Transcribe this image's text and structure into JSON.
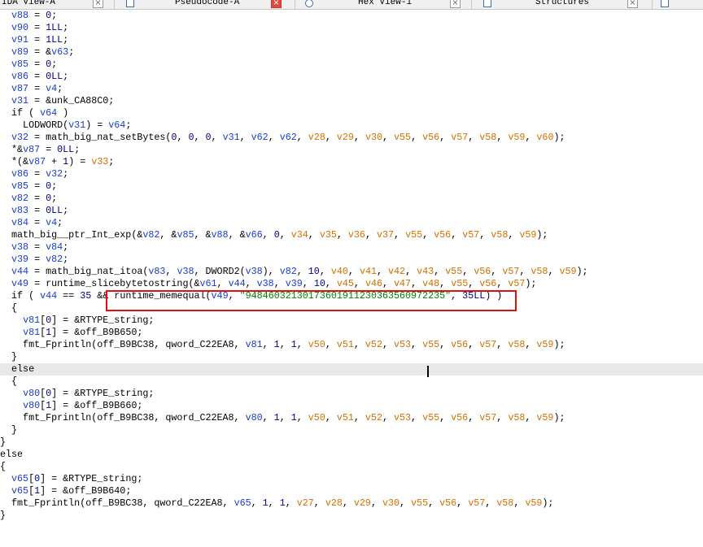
{
  "tabs": [
    {
      "label": "IDA View-A",
      "active": false
    },
    {
      "label": "Pseudocode-A",
      "active": true
    },
    {
      "label": "Hex View-1",
      "active": false
    },
    {
      "label": "Structures",
      "active": false
    }
  ],
  "code": {
    "lines": [
      "  v88 = 0;",
      "  v90 = 1LL;",
      "  v91 = 1LL;",
      "  v89 = &v63;",
      "  v85 = 0;",
      "  v86 = 0LL;",
      "  v87 = v4;",
      "  v31 = &unk_CA88C0;",
      "  if ( v64 )",
      "    LODWORD(v31) = v64;",
      "  v32 = math_big_nat_setBytes(0, 0, 0, v31, v62, v62, v28, v29, v30, v55, v56, v57, v58, v59, v60);",
      "  *&v87 = 0LL;",
      "  *(&v87 + 1) = v33;",
      "  v86 = v32;",
      "  v85 = 0;",
      "  v82 = 0;",
      "  v83 = 0LL;",
      "  v84 = v4;",
      "  math_big__ptr_Int_exp(&v82, &v85, &v88, &v66, 0, v34, v35, v36, v37, v55, v56, v57, v58, v59);",
      "  v38 = v84;",
      "  v39 = v82;",
      "  v44 = math_big_nat_itoa(v83, v38, DWORD2(v38), v82, 10, v40, v41, v42, v43, v55, v56, v57, v58, v59);",
      "  v49 = runtime_slicebytetostring(&v61, v44, v38, v39, 10, v45, v46, v47, v48, v55, v56, v57);",
      "  if ( v44 == 35 && runtime_memequal(v49, \"94846032130173601911230363560972235\", 35LL) )",
      "  {",
      "    v81[0] = &RTYPE_string;",
      "    v81[1] = &off_B9B650;",
      "    fmt_Fprintln(off_B9BC38, qword_C22EA8, v81, 1, 1, v50, v51, v52, v53, v55, v56, v57, v58, v59);",
      "  }",
      "  else",
      "  {",
      "    v80[0] = &RTYPE_string;",
      "    v80[1] = &off_B9B660;",
      "    fmt_Fprintln(off_B9BC38, qword_C22EA8, v80, 1, 1, v50, v51, v52, v53, v55, v56, v57, v58, v59);",
      "  }",
      "}",
      "else",
      "{",
      "  v65[0] = &RTYPE_string;",
      "  v65[1] = &off_B9B640;",
      "  fmt_Fprintln(off_B9BC38, qword_C22EA8, v65, 1, 1, v27, v28, v29, v30, v55, v56, v57, v58, v59);",
      "}"
    ],
    "highlighted_call": "runtime_memequal(v49, \"94846032130173601911230363560972235\", 35LL) )",
    "current_line_index": 29
  },
  "colors": {
    "variable": "#1a3cc8",
    "number": "#000080",
    "string": "#008000",
    "argument": "#d07000",
    "highlight_box": "#e01010"
  }
}
